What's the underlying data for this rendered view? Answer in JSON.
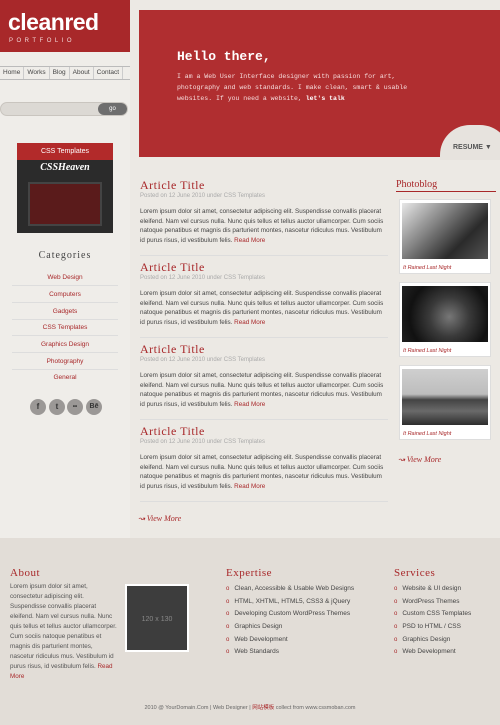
{
  "logo": {
    "main": "cleanred",
    "sub": "PORTFOLIO"
  },
  "nav": [
    "Home",
    "Works",
    "Blog",
    "About",
    "Contact"
  ],
  "search": {
    "placeholder": "",
    "button": "go"
  },
  "ad": {
    "top": "CSS Templates",
    "title": "CSSHeaven"
  },
  "categories": {
    "title": "Categories",
    "items": [
      "Web Design",
      "Computers",
      "Gadgets",
      "CSS Templates",
      "Graphics Design",
      "Photography",
      "General"
    ]
  },
  "social": [
    "f",
    "t",
    "••",
    "Bē"
  ],
  "hero": {
    "title": "Hello there,",
    "text": "I am a Web User Interface designer with passion for art, photography and web standards. I make clean, smart & usable websites. If you need a website,",
    "cta": "let's talk",
    "resume": "RESUME"
  },
  "articles": [
    {
      "title": "Article Title",
      "meta": "Posted on 12 June 2010 under CSS Templates",
      "body": "Lorem ipsum dolor sit amet, consectetur adipiscing elit. Suspendisse convallis placerat eleifend. Nam vel cursus nulla. Nunc quis tellus et tellus auctor ullamcorper. Cum sociis natoque penatibus et magnis dis parturient montes, nascetur ridiculus mus. Vestibulum id purus risus, id vestibulum felis.",
      "more": "Read More"
    },
    {
      "title": "Article Title",
      "meta": "Posted on 12 June 2010 under CSS Templates",
      "body": "Lorem ipsum dolor sit amet, consectetur adipiscing elit. Suspendisse convallis placerat eleifend. Nam vel cursus nulla. Nunc quis tellus et tellus auctor ullamcorper. Cum sociis natoque penatibus et magnis dis parturient montes, nascetur ridiculus mus. Vestibulum id purus risus, id vestibulum felis.",
      "more": "Read More"
    },
    {
      "title": "Article Title",
      "meta": "Posted on 12 June 2010 under CSS Templates",
      "body": "Lorem ipsum dolor sit amet, consectetur adipiscing elit. Suspendisse convallis placerat eleifend. Nam vel cursus nulla. Nunc quis tellus et tellus auctor ullamcorper. Cum sociis natoque penatibus et magnis dis parturient montes, nascetur ridiculus mus. Vestibulum id purus risus, id vestibulum felis.",
      "more": "Read More"
    },
    {
      "title": "Article Title",
      "meta": "Posted on 12 June 2010 under CSS Templates",
      "body": "Lorem ipsum dolor sit amet, consectetur adipiscing elit. Suspendisse convallis placerat eleifend. Nam vel cursus nulla. Nunc quis tellus et tellus auctor ullamcorper. Cum sociis natoque penatibus et magnis dis parturient montes, nascetur ridiculus mus. Vestibulum id purus risus, id vestibulum felis.",
      "more": "Read More"
    }
  ],
  "view_more": "View More",
  "photoblog": {
    "title": "Photoblog",
    "captions": [
      "It Rained Last Night",
      "It Rained Last Night",
      "It Rained Last Night"
    ]
  },
  "footer": {
    "about_title": "About",
    "about_text": "Lorem ipsum dolor sit amet, consectetur adipiscing elit. Suspendisse convallis placerat eleifend. Nam vel cursus nulla. Nunc quis tellus et tellus auctor ullamcorper. Cum sociis natoque penatibus et magnis dis parturient montes, nascetur ridiculus mus. Vestibulum id purus risus, id vestibulum felis.",
    "about_more": "Read More",
    "placeholder": "120 x 130",
    "expertise_title": "Expertise",
    "expertise": [
      "Clean, Accessible & Usable Web Designs",
      "HTML, XHTML, HTML5, CSS3 & jQuery",
      "Developing Custom WordPress Themes",
      "Graphics Design",
      "Web Development",
      "Web Standards"
    ],
    "services_title": "Services",
    "services": [
      "Website & UI design",
      "WordPress Themes",
      "Custom CSS Templates",
      "PSD to HTML / CSS",
      "Graphics Design",
      "Web Development"
    ],
    "copyright_a": "2010 @ YourDomain.Com | Web Designer |",
    "copyright_b": "网站模板",
    "copyright_c": "collect from www.cssmoban.com"
  },
  "colors": {
    "accent": "#a8282a",
    "hero": "#b02e30",
    "bg": "#ece9e4",
    "footer": "#e2ddd7"
  }
}
